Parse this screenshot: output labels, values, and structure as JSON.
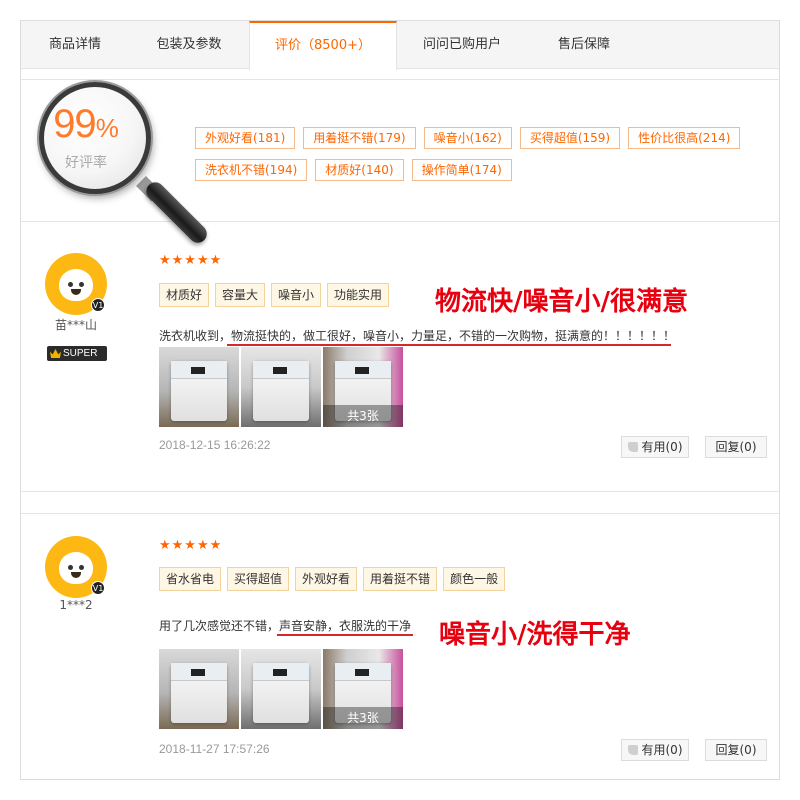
{
  "tabs": [
    {
      "label": "商品详情"
    },
    {
      "label": "包装及参数"
    },
    {
      "label": "评价（8500+）"
    },
    {
      "label": "问问已购用户"
    },
    {
      "label": "售后保障"
    }
  ],
  "summary": {
    "rate_number": "99",
    "rate_unit": "%",
    "rate_label": "好评率",
    "tags": [
      "外观好看(181)",
      "用着挺不错(179)",
      "噪音小(162)",
      "买得超值(159)",
      "性价比很高(214)",
      "洗衣机不错(194)",
      "材质好(140)",
      "操作简单(174)"
    ]
  },
  "reviews": [
    {
      "username": "苗***山",
      "level": "V1",
      "badge": "SUPER",
      "stars": "★★★★★",
      "tags": [
        "材质好",
        "容量大",
        "噪音小",
        "功能实用"
      ],
      "highlight": "物流快/噪音小/很满意",
      "comment": "洗衣机收到，物流挺快的，做工很好，噪音小，力量足，不错的一次购物，挺满意的！！！！！！",
      "photo_count": "共3张",
      "date": "2018-12-15 16:26:22",
      "useful": "有用(0)",
      "reply": "回复(0)"
    },
    {
      "username": "1***2",
      "level": "V1",
      "stars": "★★★★★",
      "tags": [
        "省水省电",
        "买得超值",
        "外观好看",
        "用着挺不错",
        "颜色一般"
      ],
      "highlight": "噪音小/洗得干净",
      "comment": "用了几次感觉还不错，声音安静，衣服洗的干净",
      "photo_count": "共3张",
      "date": "2018-11-27 17:57:26",
      "useful": "有用(0)",
      "reply": "回复(0)"
    }
  ],
  "colors": {
    "accent": "#ff6600",
    "highlight_red": "#e8000f",
    "mascot_yellow": "#fdb813"
  }
}
